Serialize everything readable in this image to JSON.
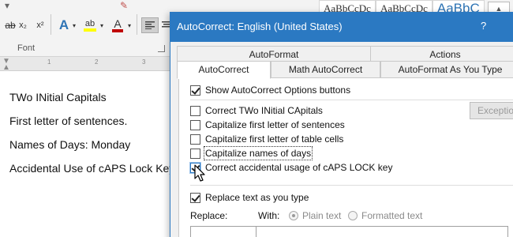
{
  "ribbon": {
    "subscript_label": "x₂",
    "superscript_label": "x²",
    "text_effects_glyph": "A",
    "highlight_glyph": "ab",
    "font_color_glyph": "A",
    "font_group_label": "Font",
    "styles": [
      "AaBbCcDc",
      "AaBbCcDc",
      "AaBbC"
    ],
    "icons": [
      "subscript-icon",
      "superscript-icon",
      "text-effects-icon",
      "highlight-icon",
      "font-color-icon",
      "align-left-icon",
      "align-center-icon",
      "scroll-up-icon"
    ],
    "colors": {
      "highlight": "#ffff00",
      "font_color": "#c00000",
      "text_effects": "#2e74b5",
      "heading_style": "#2e74b5"
    }
  },
  "ruler": {
    "marks": [
      "1",
      "2",
      "3"
    ]
  },
  "document": {
    "lines": [
      "TWo INitial Capitals",
      "First letter of sentences.",
      "Names of Days: Monday",
      "Accidental Use of cAPS Lock Key"
    ]
  },
  "dialog": {
    "title": "AutoCorrect: English (United States)",
    "help": "?",
    "accent_color": "#2b79c2",
    "tabs_row1": [
      "AutoFormat",
      "Actions"
    ],
    "tabs_row2": [
      "AutoCorrect",
      "Math AutoCorrect",
      "AutoFormat As You Type"
    ],
    "active_tab": "AutoCorrect",
    "show_options": {
      "label": "Show AutoCorrect Options buttons",
      "checked": true
    },
    "options": [
      {
        "label": "Correct TWo INitial CApitals",
        "checked": false
      },
      {
        "label": "Capitalize first letter of sentences",
        "checked": false
      },
      {
        "label": "Capitalize first letter of table cells",
        "checked": false
      },
      {
        "label": "Capitalize names of days",
        "checked": false
      },
      {
        "label": "Correct accidental usage of cAPS LOCK key",
        "checked": true
      }
    ],
    "exceptions_button": "Exceptions...",
    "replace_as_you_type": {
      "label": "Replace text as you type",
      "checked": true
    },
    "replace_label": "Replace:",
    "with_label": "With:",
    "plain_text_label": "Plain text",
    "formatted_text_label": "Formatted text",
    "replace_value": "",
    "with_value": ""
  }
}
